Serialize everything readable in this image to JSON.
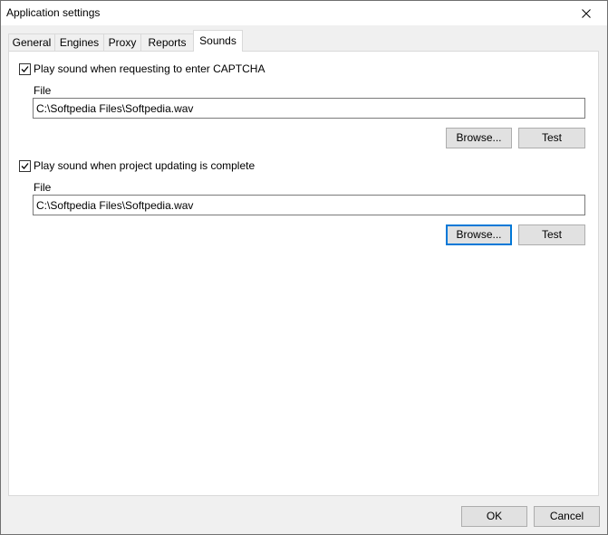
{
  "window": {
    "title": "Application settings"
  },
  "tabs": [
    {
      "label": "General"
    },
    {
      "label": "Engines"
    },
    {
      "label": "Proxy"
    },
    {
      "label": "Reports"
    },
    {
      "label": "Sounds"
    }
  ],
  "active_tab": "Sounds",
  "sounds": {
    "captcha": {
      "checkbox_label": "Play sound when requesting to enter CAPTCHA",
      "checked": true,
      "file_label": "File",
      "file_value": "C:\\Softpedia Files\\Softpedia.wav",
      "browse_label": "Browse...",
      "test_label": "Test"
    },
    "project_complete": {
      "checkbox_label": "Play sound when project updating is complete",
      "checked": true,
      "file_label": "File",
      "file_value": "C:\\Softpedia Files\\Softpedia.wav",
      "browse_label": "Browse...",
      "test_label": "Test"
    }
  },
  "footer": {
    "ok_label": "OK",
    "cancel_label": "Cancel"
  },
  "colors": {
    "focus_accent": "#0078d7",
    "button_face": "#e1e1e1",
    "window_bg": "#f0f0f0"
  },
  "icons": {
    "close": "close-icon",
    "check": "checkmark-icon"
  }
}
